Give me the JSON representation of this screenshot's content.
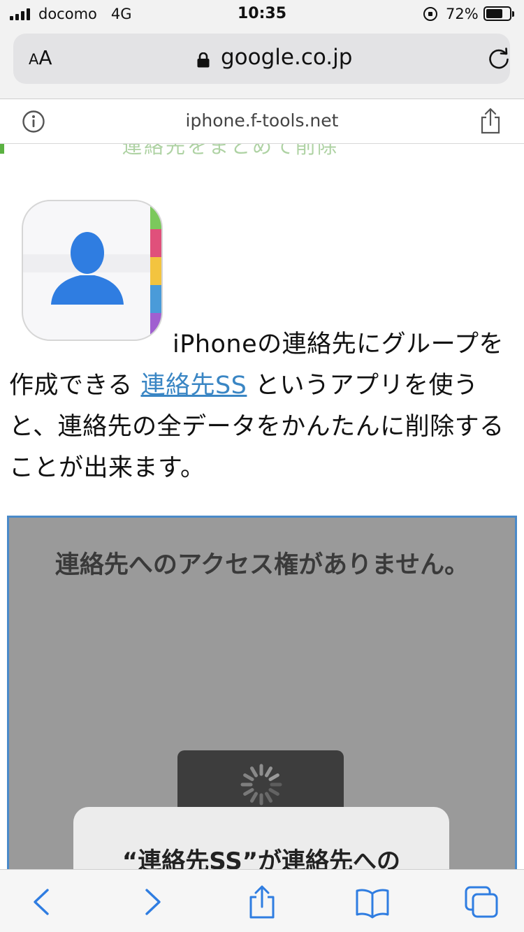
{
  "status_bar": {
    "carrier": "docomo",
    "network": "4G",
    "time": "10:35",
    "battery_percent": "72%",
    "battery_level": 0.72
  },
  "address_bar": {
    "aa_small": "A",
    "aa_large": "A",
    "url": "google.co.jp",
    "icons": [
      "lock-icon",
      "reload-icon"
    ]
  },
  "site_bar": {
    "host": "iphone.f-tools.net",
    "icons": [
      "info-icon",
      "share-icon"
    ]
  },
  "content": {
    "cut_heading": "連絡先をまとめて削除",
    "app_icon": "contacts-app-icon",
    "paragraph": {
      "before_link": "iPhoneの連絡先にグループを作成できる",
      "link": "連絡先SS",
      "after_link": "というアプリを使うと、連絡先の全データをかんたんに削除することが出来ます。"
    },
    "embedded_screenshot": {
      "message": "連絡先へのアクセス権がありません。",
      "dialog_title": "“連絡先SS”が連絡先への"
    }
  },
  "toolbar": {
    "buttons": [
      "back-icon",
      "forward-icon",
      "share-icon",
      "bookmarks-icon",
      "tabs-icon"
    ]
  },
  "colors": {
    "link": "#3a86c4",
    "accent_blue": "#2f7de1",
    "frame_border": "#4a8ac9",
    "green_marker": "#5ab141"
  }
}
